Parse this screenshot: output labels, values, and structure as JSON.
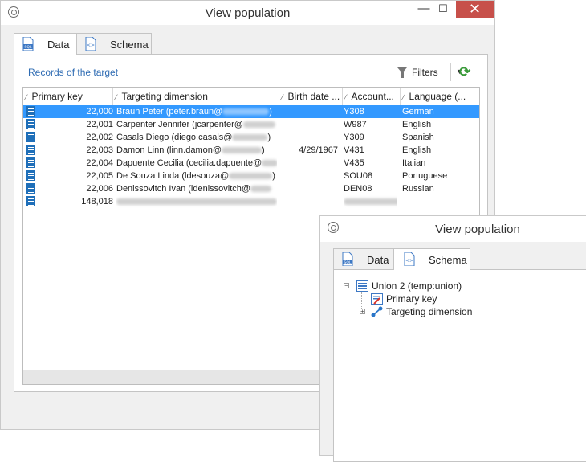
{
  "main_window": {
    "title": "View population",
    "controls": {
      "minimize": "—",
      "maximize": "☐",
      "close": "✕"
    },
    "tabs": [
      {
        "label": "Data",
        "icon": "sql-file-icon",
        "active": true
      },
      {
        "label": "Schema",
        "icon": "schema-file-icon",
        "active": false
      }
    ],
    "records_link": "Records of the target",
    "filters_label": "Filters",
    "columns": [
      "Primary key",
      "Targeting dimension",
      "Birth date ...",
      "Account...",
      "Language (..."
    ],
    "rows": [
      {
        "key": "22,000",
        "name": "Braun Peter (peter.braun@",
        "name_end": ")",
        "birth": "",
        "account": "Y308",
        "language": "German",
        "selected": true
      },
      {
        "key": "22,001",
        "name": "Carpenter Jennifer (jcarpenter@",
        "name_end": "",
        "birth": "",
        "account": "W987",
        "language": "English",
        "selected": false
      },
      {
        "key": "22,002",
        "name": "Casals Diego (diego.casals@",
        "name_end": ")",
        "birth": "",
        "account": "Y309",
        "language": "Spanish",
        "selected": false
      },
      {
        "key": "22,003",
        "name": "Damon Linn (linn.damon@",
        "name_end": ")",
        "birth": "4/29/1967",
        "account": "V431",
        "language": "English",
        "selected": false
      },
      {
        "key": "22,004",
        "name": "Dapuente Cecilia (cecilia.dapuente@",
        "name_end": "",
        "birth": "",
        "account": "V435",
        "language": "Italian",
        "selected": false
      },
      {
        "key": "22,005",
        "name": "De Souza Linda (ldesouza@",
        "name_end": ")",
        "birth": "",
        "account": "SOU08",
        "language": "Portuguese",
        "selected": false
      },
      {
        "key": "22,006",
        "name": "Denissovitch Ivan (idenissovitch@",
        "name_end": "",
        "birth": "",
        "account": "DEN08",
        "language": "Russian",
        "selected": false
      },
      {
        "key": "148,018",
        "name": "",
        "name_end": "",
        "birth": "",
        "account": "",
        "language": "",
        "selected": false
      }
    ]
  },
  "schema_window": {
    "title": "View population",
    "tabs": [
      {
        "label": "Data",
        "icon": "sql-file-icon",
        "active": false
      },
      {
        "label": "Schema",
        "icon": "schema-file-icon",
        "active": true
      }
    ],
    "tree": {
      "root": "Union 2 (temp:union)",
      "children": [
        "Primary key",
        "Targeting dimension"
      ]
    }
  },
  "colors": {
    "selection": "#3399ff",
    "link": "#2f6cb3",
    "close_button": "#c7504a",
    "refresh": "#3a9b3a",
    "record_icon": "#1f6fb9"
  }
}
